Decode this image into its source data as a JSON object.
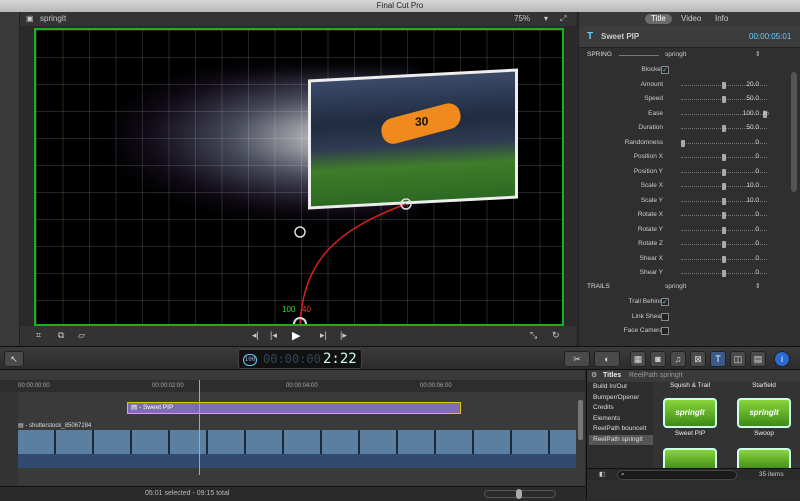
{
  "app": {
    "title": "Final Cut Pro"
  },
  "viewer": {
    "clip_name": "springIt",
    "zoom": "75%"
  },
  "canvas": {
    "overlay_green": "100",
    "overlay_red": "40",
    "player_number": "30"
  },
  "inspector": {
    "tabs": [
      "Title",
      "Video",
      "Info"
    ],
    "selected_tab": "Title",
    "title_name": "Sweet PIP",
    "timecode": "00:00:05:01",
    "spring_section": "SPRING",
    "spring_preset": "springIt",
    "trails_section": "TRAILS",
    "trails_preset": "springIt",
    "params": [
      {
        "label": "Blocker",
        "type": "check",
        "checked": true
      },
      {
        "label": "Amount",
        "value": "20.0",
        "knob": 0.5
      },
      {
        "label": "Speed",
        "value": "50.0",
        "knob": 0.5
      },
      {
        "label": "Ease",
        "value": "100.0",
        "unit": "%",
        "knob": 1.0
      },
      {
        "label": "Duration",
        "value": "50.0",
        "knob": 0.5
      },
      {
        "label": "Randomness",
        "value": "0",
        "knob": 0.0
      },
      {
        "label": "Position X",
        "value": "0",
        "knob": 0.5
      },
      {
        "label": "Position Y",
        "value": "0",
        "knob": 0.5
      },
      {
        "label": "Scale X",
        "value": "10.0",
        "knob": 0.5
      },
      {
        "label": "Scale Y",
        "value": "10.0",
        "knob": 0.5
      },
      {
        "label": "Rotate X",
        "value": "0",
        "knob": 0.5
      },
      {
        "label": "Rotate Y",
        "value": "0",
        "knob": 0.5
      },
      {
        "label": "Rotate Z",
        "value": "0",
        "knob": 0.5
      },
      {
        "label": "Shear X",
        "value": "0",
        "knob": 0.5
      },
      {
        "label": "Shear Y",
        "value": "0",
        "knob": 0.5
      }
    ],
    "trail_params": [
      {
        "label": "Trail Behind",
        "type": "check",
        "checked": true
      },
      {
        "label": "Link Shear",
        "type": "check",
        "checked": false
      },
      {
        "label": "Face Camera",
        "type": "check",
        "checked": false
      }
    ]
  },
  "toolbar": {
    "timecode": "2:22",
    "timecode_ghost": "00:00:00",
    "tc_badge": "100"
  },
  "timeline": {
    "ruler": [
      "00:00:00:00",
      "00:00:02:00",
      "00:00:04:00",
      "00:00:06:00"
    ],
    "title_clip": "Sweet PIP",
    "video_clip": "shutterstock_85067284",
    "status": "05:01 selected - 09:15 total"
  },
  "browser": {
    "header": "Titles",
    "breadcrumb": "ReelPath springIt",
    "categories": [
      "Build In/Out",
      "Bumper/Opener",
      "Credits",
      "Elements",
      "ReelPath bounceIt",
      "ReelPath springIt"
    ],
    "selected_category": "ReelPath springIt",
    "col_head_1": "Squish & Trail",
    "col_head_2": "Starfield",
    "items": [
      "Sweet PIP",
      "Swoop"
    ],
    "thumb_text": "springIt",
    "count": "35 items"
  }
}
